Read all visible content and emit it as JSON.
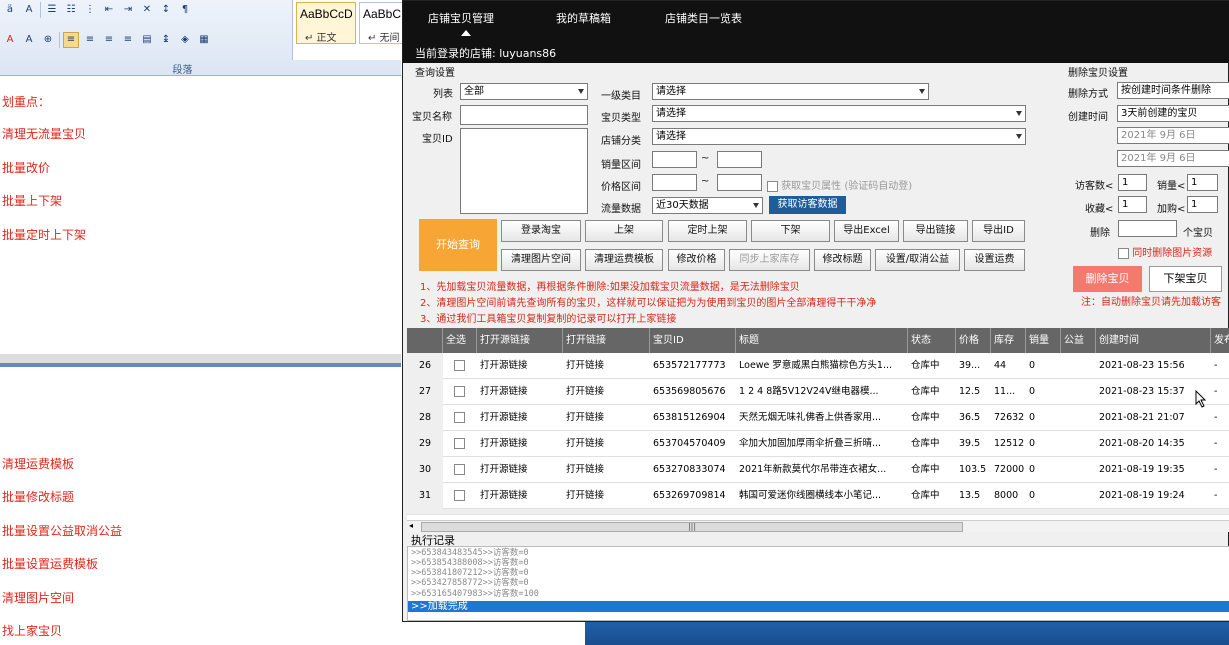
{
  "word": {
    "style_samples": [
      {
        "sample": "AaBbCcD",
        "name": "↵ 正文"
      },
      {
        "sample": "AaBbC",
        "name": "↵ 无间"
      }
    ],
    "ribbon_group_label": "段落",
    "doc_lines_top": [
      "划重点：",
      "清理无流量宝贝",
      "批量改价",
      "批量上下架",
      "批量定时上下架"
    ],
    "doc_lines_bottom": [
      "清理运费模板",
      "批量修改标题",
      "批量设置公益取消公益",
      "批量设置运费模板",
      "清理图片空间",
      "找上家宝贝"
    ]
  },
  "app": {
    "tabs": [
      "店铺宝贝管理",
      "我的草稿箱",
      "店铺类目一览表"
    ],
    "current_shop": "当前登录的店铺: luyuans86",
    "query": {
      "section_title": "查询设置",
      "list_label": "列表",
      "list_value": "全部",
      "item_name_label": "宝贝名称",
      "item_id_label": "宝贝ID",
      "cat1_label": "一级类目",
      "cat1_value": "请选择",
      "type_label": "宝贝类型",
      "type_value": "请选择",
      "shopcat_label": "店铺分类",
      "shopcat_value": "请选择",
      "sales_label": "销量区间",
      "price_label": "价格区间",
      "tilde": "~",
      "attr_checkbox": "获取宝贝属性 (验证码自动登)",
      "traffic_label": "流量数据",
      "traffic_value": "近30天数据",
      "fetch_button": "获取访客数据"
    },
    "start_button": "开始查询",
    "buttons_row1": [
      "登录淘宝",
      "上架",
      "定时上架",
      "下架",
      "导出Excel",
      "导出链接",
      "导出ID"
    ],
    "buttons_row2": [
      "清理图片空间",
      "清理运费模板",
      "修改价格",
      "同步上家库存",
      "修改标题",
      "设置/取消公益",
      "设置运费"
    ],
    "notes": [
      "1、先加载宝贝流量数据，再根据条件删除:如果没加载宝贝流量数据，是无法删除宝贝",
      "2、清理图片空间前请先查询所有的宝贝，这样就可以保证把为为使用到宝贝的图片全部清理得干干净净",
      "3、通过我们工具箱宝贝复制复制的记录可以打开上家链接"
    ],
    "delete": {
      "title": "删除宝贝设置",
      "mode_label": "删除方式",
      "mode_value": "按创建时间条件删除",
      "ctime_label": "创建时间",
      "ctime_value": "3天前创建的宝贝",
      "date1": "2021年 9月 6日",
      "date2": "2021年 9月 6日",
      "visitors_label": "访客数<",
      "visitors_value": "1",
      "sales_label": "销量<",
      "sales_value": "1",
      "fav_label": "收藏<",
      "fav_value": "1",
      "cart_label": "加购<",
      "cart_value": "1",
      "delete_label": "删除",
      "unit": "个宝贝",
      "also_images": "同时删除图片资源",
      "delete_button": "删除宝贝",
      "offshelf_button": "下架宝贝",
      "note": "注：自动删除宝贝请先加载访客"
    },
    "table": {
      "headers": [
        "全选",
        "打开源链接",
        "打开链接",
        "宝贝ID",
        "标题",
        "状态",
        "价格",
        "库存",
        "销量",
        "公益",
        "创建时间",
        "发布"
      ],
      "rows": [
        {
          "n": "26",
          "src": "打开源链接",
          "link": "打开链接",
          "id": "653572177773",
          "title": "Loewe 罗意威黑白熊猫棕色方头1...",
          "status": "仓库中",
          "price": "39...",
          "stock": "44",
          "sales": "0",
          "charity": "",
          "created": "2021-08-23 15:56",
          "pub": "-"
        },
        {
          "n": "27",
          "src": "打开源链接",
          "link": "打开链接",
          "id": "653569805676",
          "title": "1 2 4 8路5V12V24V继电器模...",
          "status": "仓库中",
          "price": "12.5",
          "stock": "11...",
          "sales": "0",
          "charity": "",
          "created": "2021-08-23 15:37",
          "pub": "-"
        },
        {
          "n": "28",
          "src": "打开源链接",
          "link": "打开链接",
          "id": "653815126904",
          "title": "天然无烟无味礼佛香上供香家用...",
          "status": "仓库中",
          "price": "36.5",
          "stock": "72632",
          "sales": "0",
          "charity": "",
          "created": "2021-08-21 21:07",
          "pub": "-"
        },
        {
          "n": "29",
          "src": "打开源链接",
          "link": "打开链接",
          "id": "653704570409",
          "title": "伞加大加固加厚雨伞折叠三折晴...",
          "status": "仓库中",
          "price": "39.5",
          "stock": "12512",
          "sales": "0",
          "charity": "",
          "created": "2021-08-20 14:35",
          "pub": "-"
        },
        {
          "n": "30",
          "src": "打开源链接",
          "link": "打开链接",
          "id": "653270833074",
          "title": "2021年新款莫代尔吊带连衣裙女...",
          "status": "仓库中",
          "price": "103.5",
          "stock": "72000",
          "sales": "0",
          "charity": "",
          "created": "2021-08-19 19:35",
          "pub": "-"
        },
        {
          "n": "31",
          "src": "打开源链接",
          "link": "打开链接",
          "id": "653269709814",
          "title": "韩国可爱迷你线圈横线本小笔记...",
          "status": "仓库中",
          "price": "13.5",
          "stock": "8000",
          "sales": "0",
          "charity": "",
          "created": "2021-08-19 19:24",
          "pub": "-"
        }
      ]
    },
    "log": {
      "title": "执行记录",
      "lines": [
        ">>653843483545>>访客数=0",
        ">>653854388008>>访客数=0",
        ">>653841807212>>访客数=0",
        ">>653427858772>>访客数=0",
        ">>653165407983>>访客数=100"
      ],
      "active": ">>加载完成"
    }
  }
}
